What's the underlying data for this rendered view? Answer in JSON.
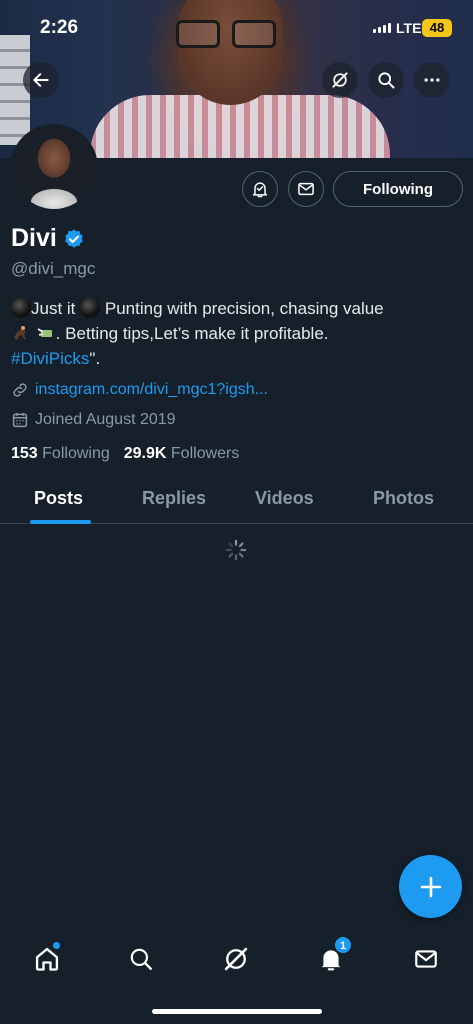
{
  "status_bar": {
    "time": "2:26",
    "network": "LTE",
    "battery": "48"
  },
  "profile": {
    "name": "Divi",
    "handle": "@divi_mgc",
    "bio_line1_a": "Just it",
    "bio_line1_b": " Punting with precision, chasing value",
    "bio_line2": ". Betting tips,Let’s make it profitable.",
    "bio_hashtag": "#DiviPicks",
    "bio_hashtag_suffix": "\".",
    "link": "instagram.com/divi_mgc1?igsh...",
    "joined": "Joined August 2019",
    "following_count": "153",
    "following_label": "Following",
    "followers_count": "29.9K",
    "followers_label": "Followers"
  },
  "actions": {
    "following_button": "Following"
  },
  "tabs": [
    {
      "label": "Posts",
      "active": true
    },
    {
      "label": "Replies",
      "active": false
    },
    {
      "label": "Videos",
      "active": false
    },
    {
      "label": "Photos",
      "active": false
    }
  ],
  "bottom_nav": {
    "items": [
      "home-icon",
      "search-icon",
      "grok-icon",
      "notifications-icon",
      "messages-icon"
    ],
    "notification_badge": "1"
  },
  "colors": {
    "accent": "#1d9bf0",
    "background": "#15202b",
    "secondary_text": "#8b98a5"
  }
}
